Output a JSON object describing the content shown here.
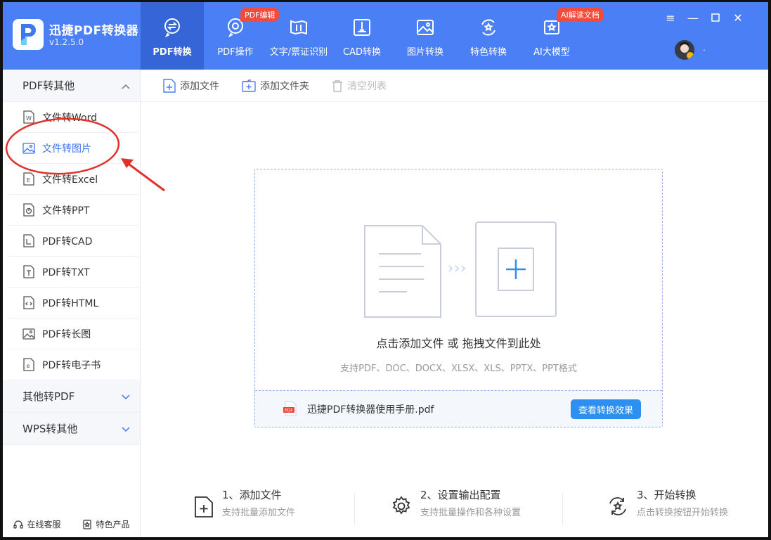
{
  "app": {
    "title": "迅捷PDF转换器",
    "version": "v1.2.5.0",
    "brand_color": "#4b7ff5",
    "accent_color": "#2d8ff0"
  },
  "nav": [
    {
      "label": "PDF转换",
      "icon": "pdf-convert-icon",
      "active": true
    },
    {
      "label": "PDF操作",
      "icon": "pdf-gear-icon",
      "badge": "PDF编辑"
    },
    {
      "label": "文字/票证识别",
      "icon": "ocr-scan-icon"
    },
    {
      "label": "CAD转换",
      "icon": "cad-icon"
    },
    {
      "label": "图片转换",
      "icon": "image-icon"
    },
    {
      "label": "特色转换",
      "icon": "star-convert-icon"
    },
    {
      "label": "AI大模型",
      "icon": "ai-model-icon",
      "badge": "AI解读文档"
    }
  ],
  "window_controls": [
    "≡",
    "—",
    "☐",
    "✕"
  ],
  "user": {
    "name": "."
  },
  "sidebar": {
    "group_open": "PDF转其他",
    "items": [
      {
        "label": "文件转Word",
        "icon": "word-file-icon"
      },
      {
        "label": "文件转图片",
        "icon": "image-file-icon",
        "active": true
      },
      {
        "label": "文件转Excel",
        "icon": "excel-file-icon"
      },
      {
        "label": "文件转PPT",
        "icon": "ppt-file-icon"
      },
      {
        "label": "PDF转CAD",
        "icon": "cad-file-icon"
      },
      {
        "label": "PDF转TXT",
        "icon": "txt-file-icon"
      },
      {
        "label": "PDF转HTML",
        "icon": "html-file-icon"
      },
      {
        "label": "PDF转长图",
        "icon": "long-image-icon"
      },
      {
        "label": "PDF转电子书",
        "icon": "ebook-file-icon"
      }
    ],
    "group_2": "其他转PDF",
    "group_3": "WPS转其他",
    "footer_service": "在线客服",
    "footer_products": "特色产品"
  },
  "toolbar": {
    "add_file": "添加文件",
    "add_folder": "添加文件夹",
    "clear_list": "清空列表"
  },
  "dropzone": {
    "main_text": "点击添加文件 或 拖拽文件到此处",
    "support_text": "支持PDF、DOC、DOCX、XLSX、XLS、PPTX、PPT格式",
    "sample_file": "迅捷PDF转换器使用手册.pdf",
    "sample_button": "查看转换效果"
  },
  "steps": [
    {
      "title": "1、添加文件",
      "sub": "支持批量添加文件",
      "icon": "add-file-icon"
    },
    {
      "title": "2、设置输出配置",
      "sub": "支持批量操作和各种设置",
      "icon": "settings-gear-icon"
    },
    {
      "title": "3、开始转换",
      "sub": "点击转换按钮开始转换",
      "icon": "convert-start-icon"
    }
  ]
}
